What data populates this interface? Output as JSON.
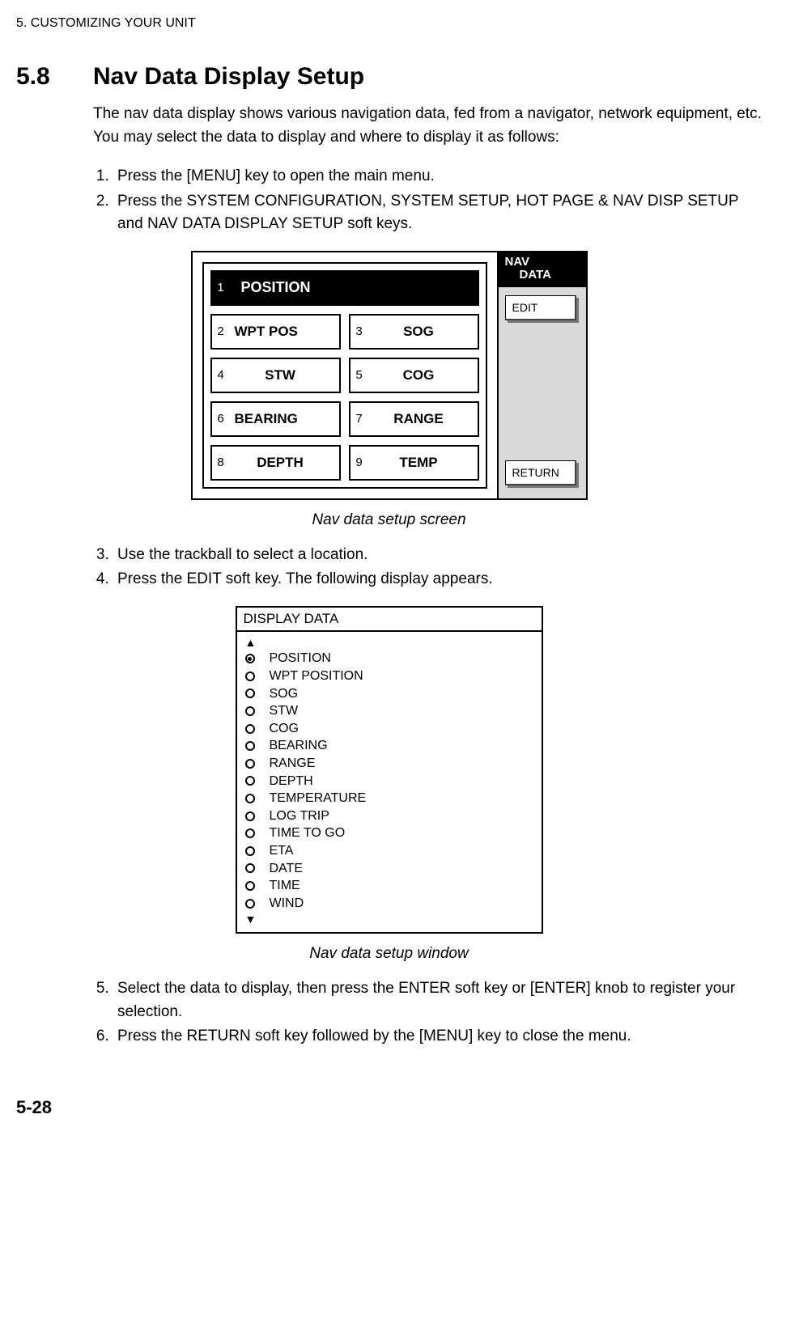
{
  "chapter_header": "5. CUSTOMIZING YOUR UNIT",
  "section_num": "5.8",
  "section_title": "Nav Data Display Setup",
  "intro": "The nav data display shows various navigation data, fed from a navigator, network equipment, etc. You may select the data to display and where to display it as follows:",
  "steps_a": [
    "Press the [MENU] key to open the main menu.",
    "Press the SYSTEM CONFIGURATION, SYSTEM SETUP, HOT PAGE & NAV DISP SETUP and NAV DATA DISPLAY SETUP soft keys."
  ],
  "fig1": {
    "cells": {
      "c1": {
        "num": "1",
        "label": "POSITION"
      },
      "c2": {
        "num": "2",
        "label": "WPT POS"
      },
      "c3": {
        "num": "3",
        "label": "SOG"
      },
      "c4": {
        "num": "4",
        "label": "STW"
      },
      "c5": {
        "num": "5",
        "label": "COG"
      },
      "c6": {
        "num": "6",
        "label": "BEARING"
      },
      "c7": {
        "num": "7",
        "label": "RANGE"
      },
      "c8": {
        "num": "8",
        "label": "DEPTH"
      },
      "c9": {
        "num": "9",
        "label": "TEMP"
      }
    },
    "side_label_line1": "NAV",
    "side_label_line2": "DATA",
    "edit_btn": "EDIT",
    "return_btn": "RETURN",
    "caption": "Nav data setup screen"
  },
  "steps_b": [
    "Use the trackball to select a location.",
    "Press the EDIT soft key. The following display appears."
  ],
  "fig2": {
    "header": "DISPLAY DATA",
    "options": [
      {
        "label": "POSITION",
        "selected": true
      },
      {
        "label": "WPT POSITION",
        "selected": false
      },
      {
        "label": "SOG",
        "selected": false
      },
      {
        "label": "STW",
        "selected": false
      },
      {
        "label": "COG",
        "selected": false
      },
      {
        "label": "BEARING",
        "selected": false
      },
      {
        "label": "RANGE",
        "selected": false
      },
      {
        "label": "DEPTH",
        "selected": false
      },
      {
        "label": "TEMPERATURE",
        "selected": false
      },
      {
        "label": "LOG TRIP",
        "selected": false
      },
      {
        "label": "TIME TO GO",
        "selected": false
      },
      {
        "label": "ETA",
        "selected": false
      },
      {
        "label": "DATE",
        "selected": false
      },
      {
        "label": "TIME",
        "selected": false
      },
      {
        "label": "WIND",
        "selected": false
      }
    ],
    "caption": "Nav data setup window"
  },
  "steps_c": [
    "Select the data to display, then press the ENTER soft key or [ENTER] knob to register your selection.",
    "Press the RETURN soft key followed by the [MENU] key to close the menu."
  ],
  "page_num": "5-28"
}
